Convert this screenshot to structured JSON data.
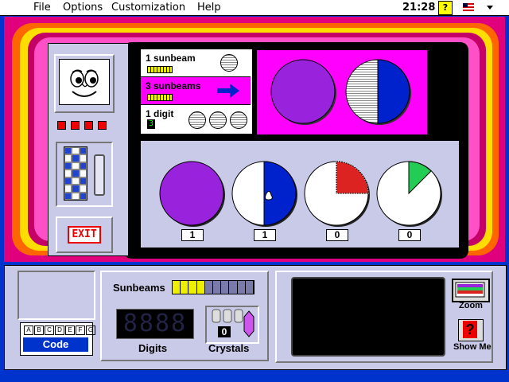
{
  "menubar": {
    "menus": [
      "File",
      "Options",
      "Customization",
      "Help"
    ],
    "clock": "21:28",
    "help_icon": "?"
  },
  "sidebar": {
    "exit_label": "EXIT"
  },
  "info_panel": {
    "row1_label": "1 sunbeam",
    "row2_label": "3 sunbeams",
    "row3_label": "1 digit",
    "digit_value": "3"
  },
  "pie_counts": [
    "1",
    "1",
    "0",
    "0"
  ],
  "bottom": {
    "sunbeams_label": "Sunbeams",
    "sunbeam_level": 0.4,
    "digits_label": "Digits",
    "digits_display": "8888",
    "crystals_label": "Crystals",
    "crystal_count": "0",
    "code_letters": [
      "A",
      "B",
      "C",
      "D",
      "E",
      "F",
      "G"
    ],
    "code_label": "Code",
    "zoom_label": "Zoom",
    "show_me_label": "Show Me",
    "show_me_icon": "?"
  },
  "colors": {
    "accent_purple": "#9922dd",
    "blue": "#0022cc",
    "magenta": "#ff00ff",
    "red_fill": "#dd2222",
    "green_fill": "#22cc55"
  }
}
